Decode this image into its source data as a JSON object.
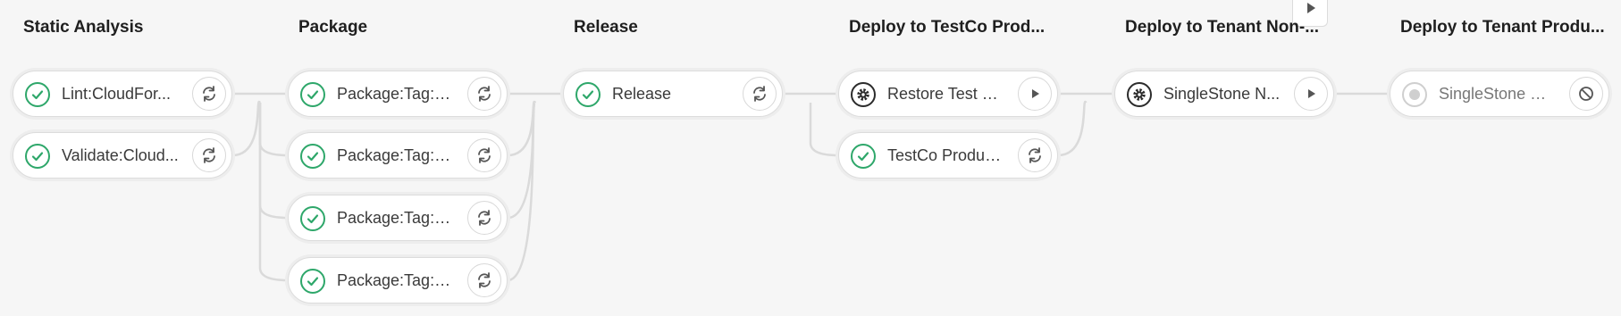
{
  "pipeline": {
    "stages": [
      {
        "title": "Static Analysis",
        "jobs": [
          {
            "label": "Lint:CloudFor...",
            "status": "success",
            "action": "retry"
          },
          {
            "label": "Validate:Cloud...",
            "status": "success",
            "action": "retry"
          }
        ]
      },
      {
        "title": "Package",
        "jobs": [
          {
            "label": "Package:Tag:E...",
            "status": "success",
            "action": "retry"
          },
          {
            "label": "Package:Tag:E...",
            "status": "success",
            "action": "retry"
          },
          {
            "label": "Package:Tag:G...",
            "status": "success",
            "action": "retry"
          },
          {
            "label": "Package:Tag:G...",
            "status": "success",
            "action": "retry"
          }
        ]
      },
      {
        "title": "Release",
        "jobs": [
          {
            "label": "Release",
            "status": "success",
            "action": "retry"
          }
        ]
      },
      {
        "title": "Deploy to TestCo Prod...",
        "jobs": [
          {
            "label": "Restore Test D...",
            "status": "manual",
            "action": "play"
          },
          {
            "label": "TestCo Produc...",
            "status": "success",
            "action": "retry"
          }
        ]
      },
      {
        "title": "Deploy to Tenant Non-...",
        "jobs": [
          {
            "label": "SingleStone N...",
            "status": "manual",
            "action": "play"
          }
        ]
      },
      {
        "title": "Deploy to Tenant Produ...",
        "jobs": [
          {
            "label": "SingleStone Pr...",
            "status": "pending",
            "action": "cancel"
          }
        ]
      }
    ]
  },
  "icons": {
    "success": "check-circle-icon",
    "manual": "gear-icon",
    "pending": "dot-circle-icon",
    "retry": "retry-icon",
    "play": "play-icon",
    "cancel": "cancel-icon",
    "flag": "play-small-icon"
  },
  "colors": {
    "background": "#f6f6f6",
    "success": "#2ea76a",
    "manual": "#2b2b2b",
    "pending": "#cfcfcf",
    "connector": "#dadada"
  }
}
